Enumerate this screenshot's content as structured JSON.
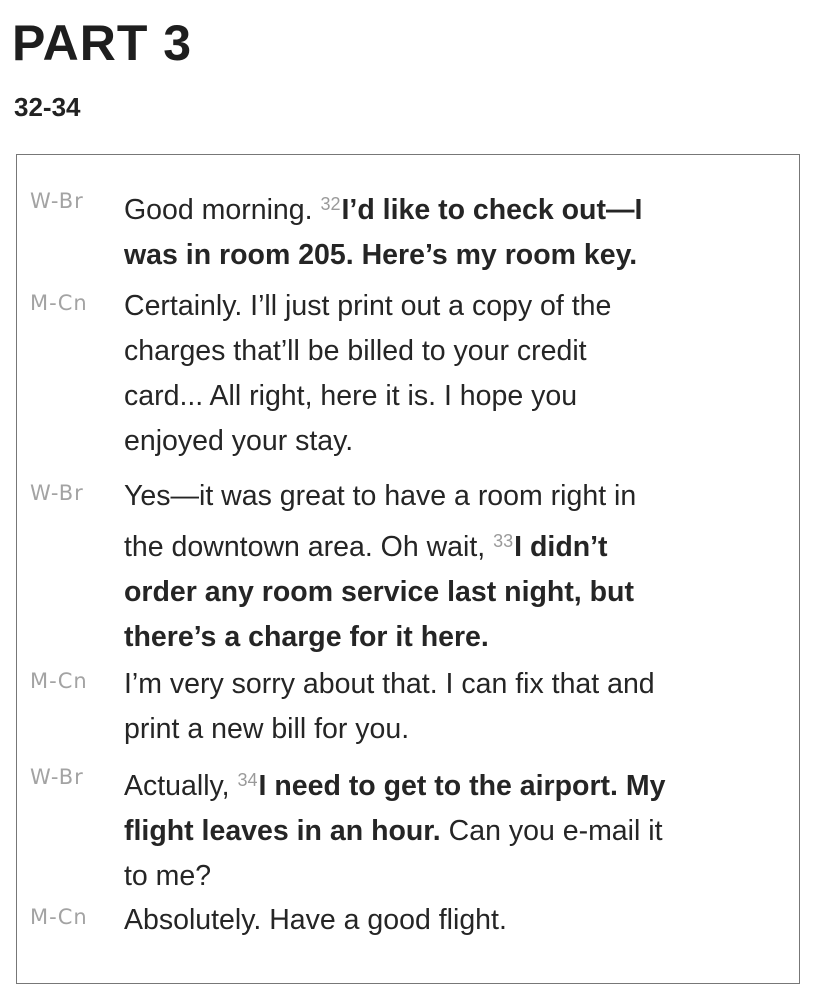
{
  "header": {
    "part_title": "PART 3",
    "question_range": "32-34"
  },
  "dialogue": [
    {
      "speaker": "W-Br",
      "segments": [
        {
          "type": "text",
          "text": "Good morning. "
        },
        {
          "type": "qnum",
          "text": "32"
        },
        {
          "type": "bold",
          "text": "I’d like to check out—I"
        },
        {
          "type": "br"
        },
        {
          "type": "bold",
          "text": "was in room 205. Here’s my room key."
        }
      ]
    },
    {
      "speaker": "M-Cn",
      "segments": [
        {
          "type": "text",
          "text": "Certainly. I’ll just print out a copy of the"
        },
        {
          "type": "br"
        },
        {
          "type": "text",
          "text": "charges that’ll be billed to your credit"
        },
        {
          "type": "br"
        },
        {
          "type": "text",
          "text": "card... All right, here it is. I hope you"
        },
        {
          "type": "br"
        },
        {
          "type": "text",
          "text": "enjoyed your stay."
        }
      ]
    },
    {
      "speaker": "W-Br",
      "segments": [
        {
          "type": "text",
          "text": "Yes—it was great to have a room right in"
        },
        {
          "type": "br"
        },
        {
          "type": "text",
          "text": "the downtown area. Oh wait, "
        },
        {
          "type": "qnum",
          "text": "33"
        },
        {
          "type": "bold",
          "text": "I didn’t"
        },
        {
          "type": "br"
        },
        {
          "type": "bold",
          "text": "order any room service last night, but"
        },
        {
          "type": "br"
        },
        {
          "type": "bold",
          "text": "there’s a charge for it here."
        }
      ]
    },
    {
      "speaker": "M-Cn",
      "segments": [
        {
          "type": "text",
          "text": "I’m very sorry about that. I can fix that and"
        },
        {
          "type": "br"
        },
        {
          "type": "text",
          "text": "print a new bill for you."
        }
      ]
    },
    {
      "speaker": "W-Br",
      "segments": [
        {
          "type": "text",
          "text": "Actually, "
        },
        {
          "type": "qnum",
          "text": "34"
        },
        {
          "type": "bold",
          "text": "I need to get to the airport. My"
        },
        {
          "type": "br"
        },
        {
          "type": "bold",
          "text": "flight leaves in an hour."
        },
        {
          "type": "text",
          "text": " Can you e-mail it"
        },
        {
          "type": "br"
        },
        {
          "type": "text",
          "text": "to me?"
        }
      ]
    },
    {
      "speaker": "M-Cn",
      "segments": [
        {
          "type": "text",
          "text": "Absolutely. Have a good flight."
        }
      ]
    }
  ]
}
